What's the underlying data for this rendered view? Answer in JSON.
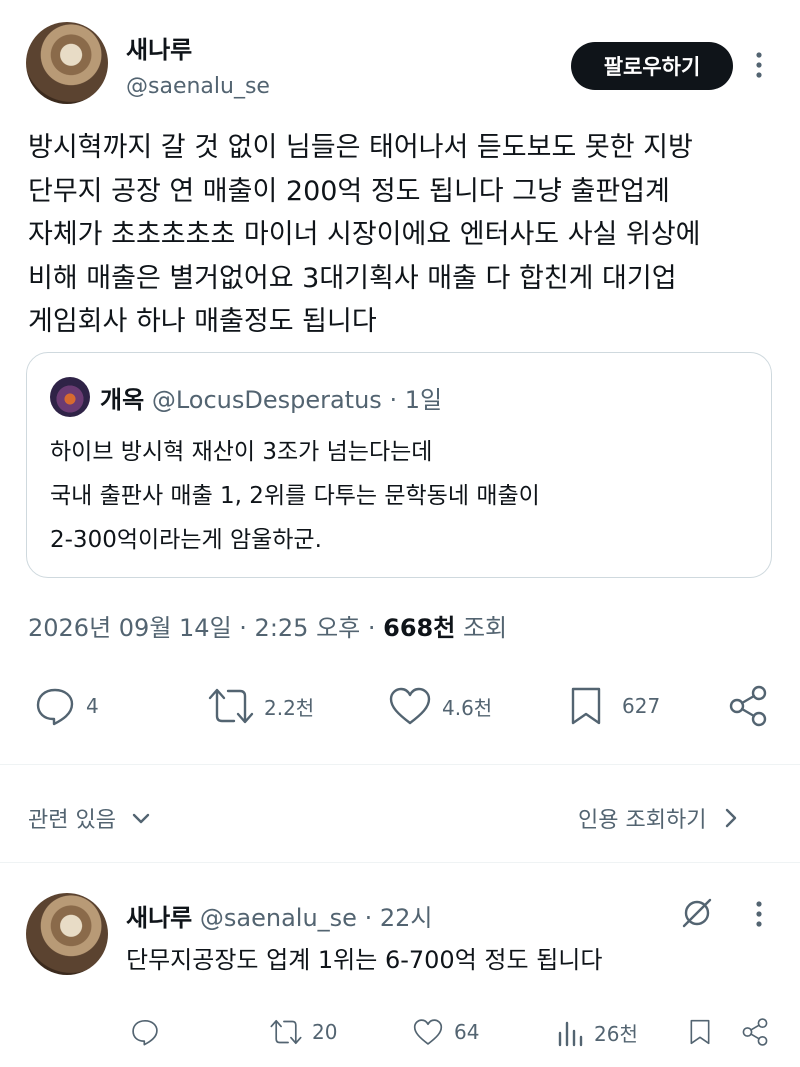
{
  "tweet": {
    "author": {
      "name": "새나루",
      "handle": "@saenalu_se"
    },
    "follow_label": "팔로우하기",
    "more_icon": "more-vertical-icon",
    "text_lines": [
      "방시혁까지 갈 것 없이 님들은 태어나서 듣도보도 못한 지방",
      "단무지 공장 연 매출이 200억 정도 됩니다 그냥 출판업계",
      "자체가 초초초초초 마이너 시장이에요 엔터사도 사실 위상에",
      "비해 매출은 별거없어요 3대기획사 매출 다 합친게 대기업",
      "게임회사 하나 매출정도 됩니다"
    ],
    "quote": {
      "name": "개옥",
      "handle": "@LocusDesperatus",
      "separator": " · ",
      "time": "1일",
      "lines": [
        "하이브 방시혁 재산이 3조가 넘는다는데",
        "국내 출판사 매출 1, 2위를 다투는 문학동네 매출이",
        "2-300억이라는게 암울하군."
      ]
    },
    "meta": {
      "date": "2026년 09월 14일",
      "separator1": " · ",
      "time": "2:25 오후",
      "separator2": " · ",
      "views_count": "668천",
      "views_label": " 조회"
    },
    "actions": {
      "replies": "4",
      "retweets": "2.2천",
      "likes": "4.6천",
      "bookmarks": "627"
    }
  },
  "related": {
    "label": "관련 있음",
    "quotes_link": "인용 조회하기"
  },
  "reply": {
    "name": "새나루",
    "handle": "@saenalu_se",
    "separator": " · ",
    "time": "22시",
    "text": "단무지공장도 업계 1위는 6-700억 정도 됩니다",
    "actions": {
      "retweets": "20",
      "likes": "64",
      "views": "26천"
    }
  },
  "colors": {
    "text": "#0f1419",
    "secondary": "#536471",
    "border": "#cfd9de",
    "button": "#0f1419"
  }
}
